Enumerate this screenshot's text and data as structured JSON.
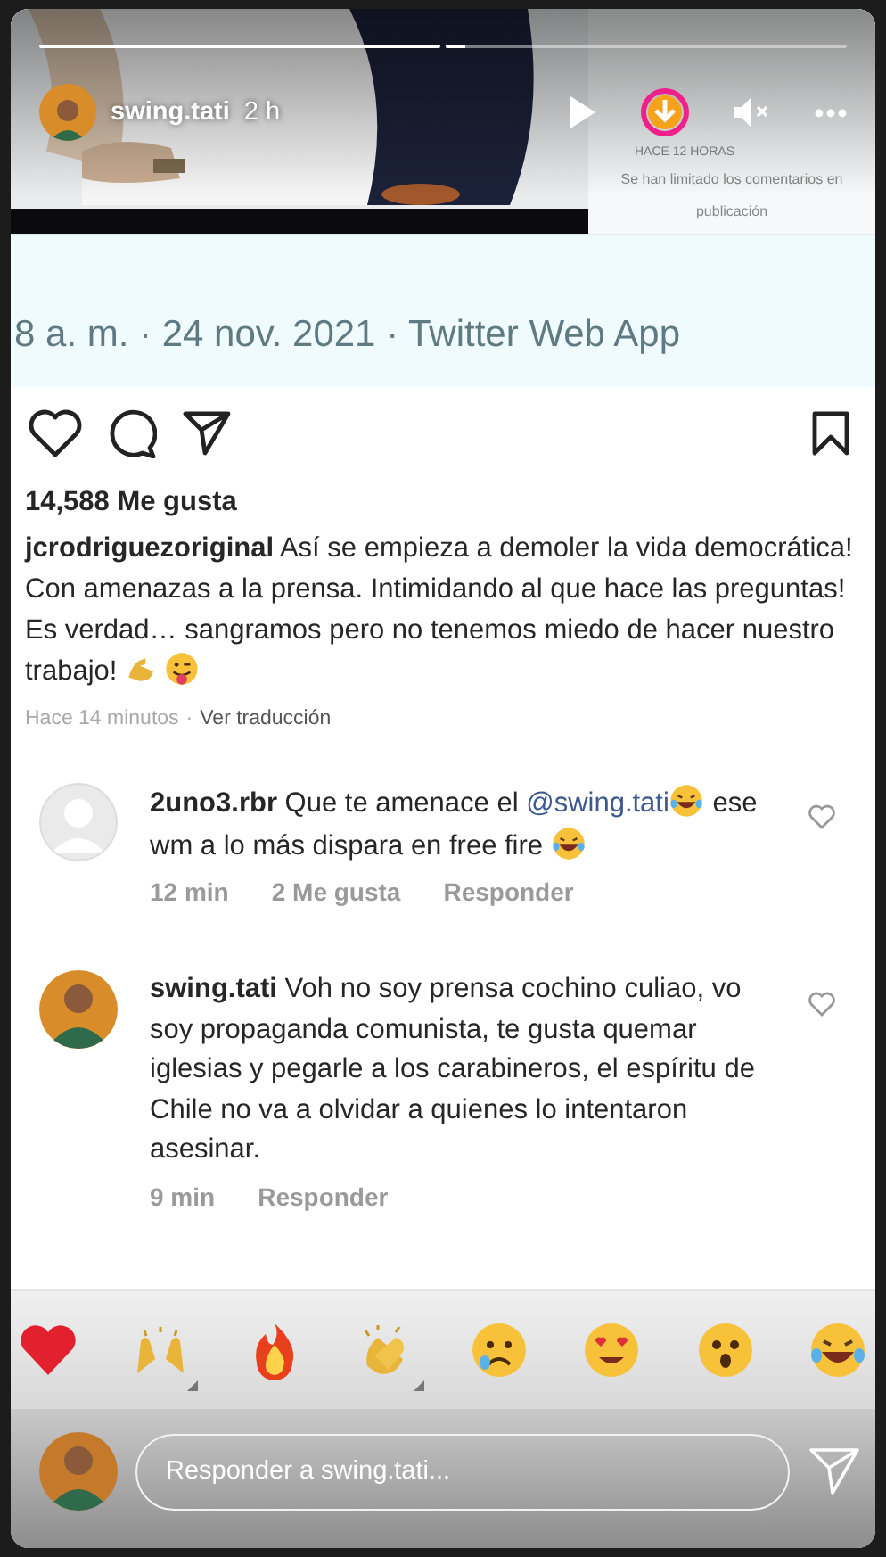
{
  "story": {
    "username": "swing.tati",
    "time": "2 h",
    "paused": true,
    "muted": true,
    "segments": [
      {
        "level": 1
      },
      {
        "level": 0.05
      }
    ]
  },
  "side_panel": {
    "time": "HACE 12 HORAS",
    "notice": [
      "Se han limitado los comentarios en",
      "publicación"
    ]
  },
  "tweet_meta": "8 a. m. · 24 nov. 2021 · Twitter Web App",
  "post": {
    "likes": "14,588 Me gusta",
    "author": "jcrodriguezoriginal",
    "caption": "Así se empieza a demoler la vida democrática! Con amenazas a la prensa. Intimidando al que hace las preguntas! Es verdad… sangramos pero no tenemos miedo de hacer nuestro trabajo!",
    "time": "Hace 14 minutos",
    "separator": "·",
    "translate": "Ver traducción"
  },
  "comments": [
    {
      "kind": "default-avatar",
      "username": "2uno3.rbr",
      "parts": [
        {
          "kind": "text",
          "text": "Que te amenace el "
        },
        {
          "kind": "mention",
          "text": "@swing.tati"
        },
        {
          "kind": "emoji"
        },
        {
          "kind": "text",
          "text": " ese wm a lo más dispara en free fire "
        },
        {
          "kind": "emoji"
        }
      ],
      "time": "12 min",
      "likes": "2 Me gusta",
      "reply": "Responder"
    },
    {
      "kind": "photo-avatar",
      "username": "swing.tati",
      "parts": [
        {
          "kind": "text",
          "text": "Voh no soy prensa cochino culiao, vo soy propaganda comunista, te gusta quemar iglesias y pegarle a los carabineros, el espíritu de Chile no va a olvidar a quienes lo intentaron asesinar."
        }
      ],
      "time": "9 min",
      "reply": "Responder"
    }
  ],
  "reactions": [
    {
      "kind": "heart"
    },
    {
      "kind": "raised-hands",
      "variants": true
    },
    {
      "kind": "fire"
    },
    {
      "kind": "clap",
      "variants": true
    },
    {
      "kind": "crying"
    },
    {
      "kind": "heart-eyes"
    },
    {
      "kind": "surprised"
    },
    {
      "kind": "laughing"
    }
  ],
  "reply_field": {
    "placeholder": "Responder a swing.tati..."
  }
}
